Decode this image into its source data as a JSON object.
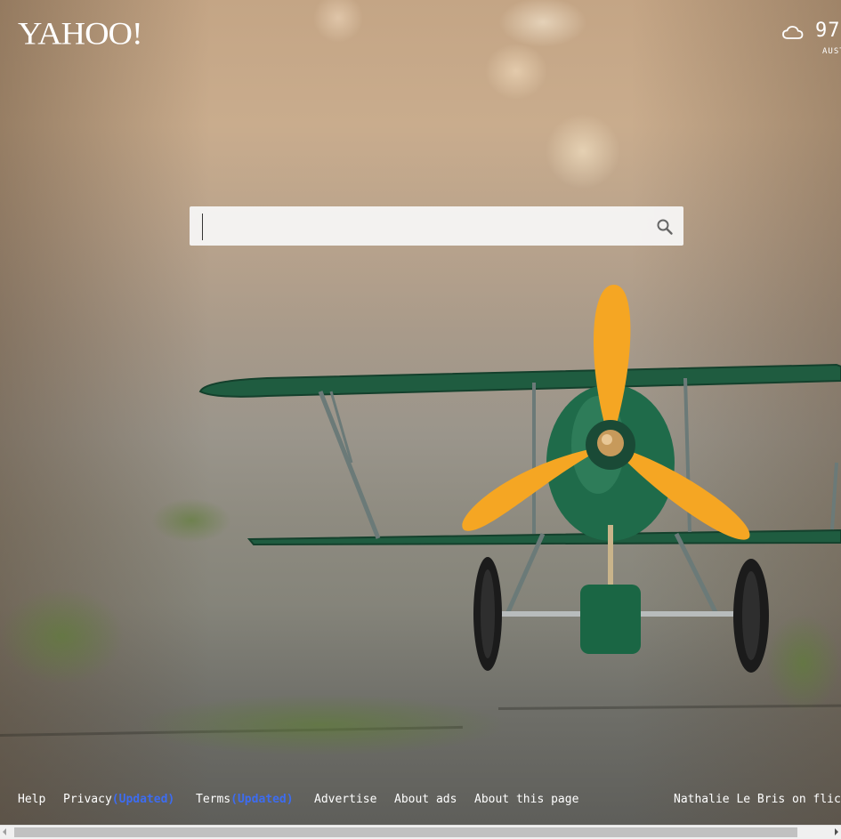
{
  "header": {
    "logo_text": "YAHOO!"
  },
  "weather": {
    "icon": "cloud-icon",
    "temperature": "97",
    "location": "AUST"
  },
  "search": {
    "value": "",
    "icon": "search-icon"
  },
  "footer": {
    "links": [
      {
        "label": "Help"
      },
      {
        "label": "Privacy",
        "badge": "(Updated)"
      },
      {
        "label": "Terms",
        "badge": "(Updated)"
      },
      {
        "label": "Advertise"
      },
      {
        "label": "About ads"
      },
      {
        "label": "About this page"
      }
    ],
    "photo_credit": "Nathalie Le Bris on flic"
  },
  "colors": {
    "updated_badge": "#3d6cf0",
    "text": "#ffffff",
    "propeller": "#f5a623",
    "plane_body": "#1f6b4a"
  }
}
